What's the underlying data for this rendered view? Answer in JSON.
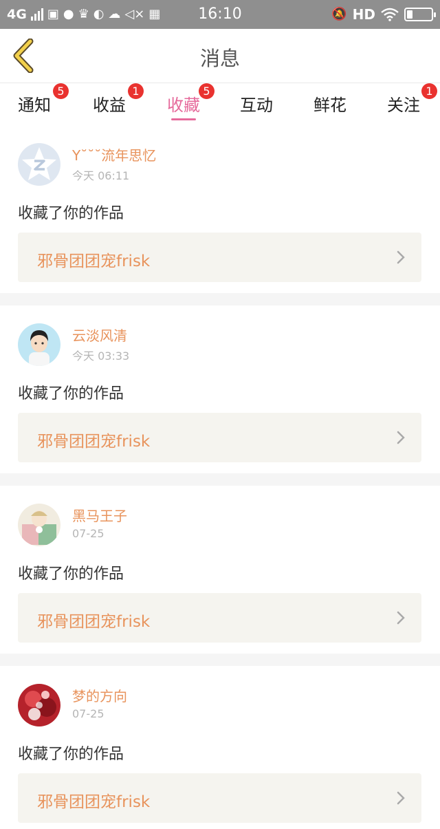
{
  "status_bar": {
    "network": "4G",
    "time": "16:10",
    "hd": "HD"
  },
  "header": {
    "title": "消息"
  },
  "tabs": [
    {
      "label": "通知",
      "badge": "5"
    },
    {
      "label": "收益",
      "badge": "1"
    },
    {
      "label": "收藏",
      "badge": "5",
      "active": true
    },
    {
      "label": "互动",
      "badge": ""
    },
    {
      "label": "鲜花",
      "badge": ""
    },
    {
      "label": "关注",
      "badge": "1"
    }
  ],
  "colors": {
    "accent_pink": "#e66a9b",
    "badge_red": "#e9322f",
    "username_orange": "#e8935c",
    "status_bar_gray": "#8f8f8f",
    "work_box_bg": "#f5f4ef"
  },
  "messages": [
    {
      "username": "Y˘˘˘流年思忆",
      "time": "今天 06:11",
      "action": "收藏了你的作品",
      "work": "邪骨团团宠frisk",
      "avatar": "qq-default-avatar"
    },
    {
      "username": "云淡风清",
      "time": "今天 03:33",
      "action": "收藏了你的作品",
      "work": "邪骨团团宠frisk",
      "avatar": "cartoon-boy-avatar"
    },
    {
      "username": "黑马王子",
      "time": "07-25",
      "action": "收藏了你的作品",
      "work": "邪骨团团宠frisk",
      "avatar": "anime-girl-avatar"
    },
    {
      "username": "梦的方向",
      "time": "07-25",
      "action": "收藏了你的作品",
      "work": "邪骨团团宠frisk",
      "avatar": "red-floral-avatar"
    }
  ]
}
